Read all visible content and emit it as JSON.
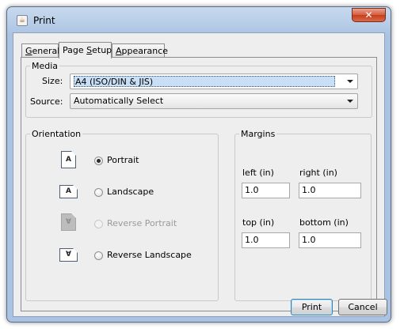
{
  "window": {
    "title": "Print",
    "close_glyph": "✕",
    "app_icon": "java-cup-icon"
  },
  "tabs": [
    {
      "label": "General",
      "underline": "G",
      "active": false
    },
    {
      "label": "Page Setup",
      "underline": "S",
      "active": true
    },
    {
      "label": "Appearance",
      "underline": "A",
      "active": false
    }
  ],
  "media": {
    "title": "Media",
    "size_label": "Size:",
    "size_value": "A4 (ISO/DIN & JIS)",
    "source_label": "Source:",
    "source_value": "Automatically Select"
  },
  "orientation": {
    "title": "Orientation",
    "options": [
      {
        "label": "Portrait",
        "icon_text": "A",
        "selected": true,
        "enabled": true
      },
      {
        "label": "Landscape",
        "icon_text": "A",
        "selected": false,
        "enabled": true
      },
      {
        "label": "Reverse Portrait",
        "icon_text": "∀",
        "selected": false,
        "enabled": false
      },
      {
        "label": "Reverse Landscape",
        "icon_text": "∀",
        "selected": false,
        "enabled": true
      }
    ]
  },
  "margins": {
    "title": "Margins",
    "left_label": "left (in)",
    "left_value": "1.0",
    "right_label": "right (in)",
    "right_value": "1.0",
    "top_label": "top (in)",
    "top_value": "1.0",
    "bottom_label": "bottom (in)",
    "bottom_value": "1.0"
  },
  "buttons": {
    "print": "Print",
    "cancel": "Cancel"
  },
  "colors": {
    "titlebar": "#b5cbe6",
    "close_button": "#c63e1b",
    "selection": "#c9dff5",
    "default_button_border": "#3c7fb1"
  }
}
